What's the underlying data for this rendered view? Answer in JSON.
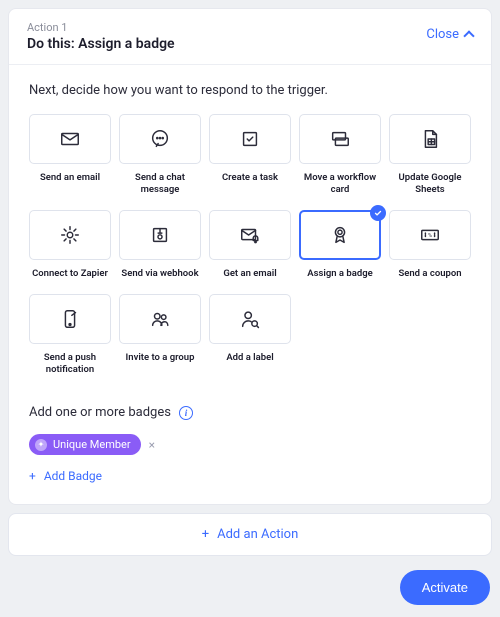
{
  "header": {
    "action_num": "Action 1",
    "title": "Do this: Assign a badge",
    "close_label": "Close"
  },
  "body": {
    "prompt": "Next, decide how you want to respond to the trigger.",
    "options": [
      {
        "id": "send-email",
        "label": "Send an email",
        "icon": "mail",
        "selected": false
      },
      {
        "id": "send-chat",
        "label": "Send a chat message",
        "icon": "chat",
        "selected": false
      },
      {
        "id": "create-task",
        "label": "Create a task",
        "icon": "checkbox",
        "selected": false
      },
      {
        "id": "move-workflow",
        "label": "Move a workflow card",
        "icon": "card-move",
        "selected": false
      },
      {
        "id": "update-sheets",
        "label": "Update Google Sheets",
        "icon": "sheet",
        "selected": false
      },
      {
        "id": "connect-zapier",
        "label": "Connect to Zapier",
        "icon": "gear",
        "selected": false
      },
      {
        "id": "send-webhook",
        "label": "Send via webhook",
        "icon": "webhook",
        "selected": false
      },
      {
        "id": "get-email",
        "label": "Get an email",
        "icon": "mail-bell",
        "selected": false
      },
      {
        "id": "assign-badge",
        "label": "Assign a badge",
        "icon": "badge",
        "selected": true
      },
      {
        "id": "send-coupon",
        "label": "Send a coupon",
        "icon": "coupon",
        "selected": false
      },
      {
        "id": "send-push",
        "label": "Send a push notification",
        "icon": "phone",
        "selected": false
      },
      {
        "id": "invite-group",
        "label": "Invite to a group",
        "icon": "group",
        "selected": false
      },
      {
        "id": "add-label",
        "label": "Add a label",
        "icon": "person-tag",
        "selected": false
      }
    ],
    "badges_heading": "Add one or more badges",
    "selected_badges": [
      {
        "name": "Unique Member"
      }
    ],
    "add_badge_label": "Add Badge"
  },
  "footer": {
    "add_action_label": "Add an Action",
    "activate_label": "Activate"
  }
}
